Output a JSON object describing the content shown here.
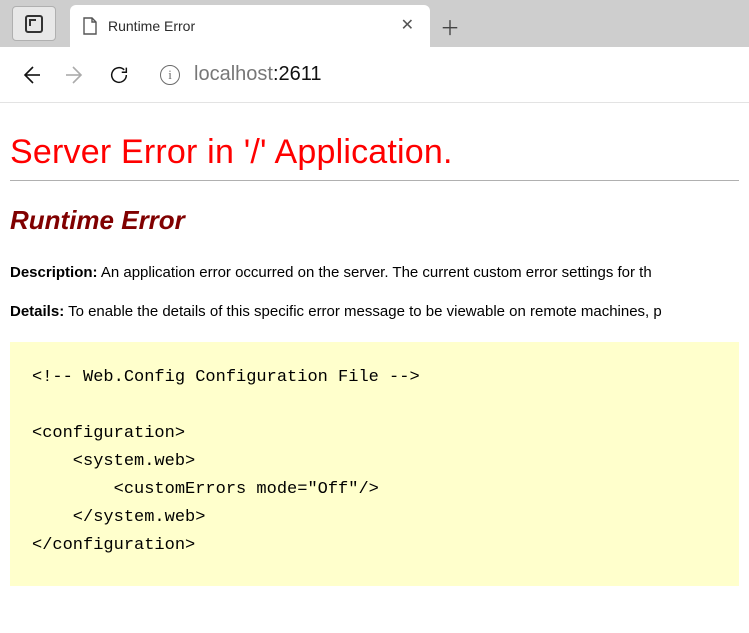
{
  "browser": {
    "tab_title": "Runtime Error",
    "address_host": "localhost",
    "address_port": ":2611"
  },
  "page": {
    "server_error_heading": "Server Error in '/' Application.",
    "runtime_heading": "Runtime Error",
    "description_label": "Description:",
    "description_text": " An application error occurred on the server. The current custom error settings for th",
    "details_label": "Details:",
    "details_text": " To enable the details of this specific error message to be viewable on remote machines, p",
    "config_code": "<!-- Web.Config Configuration File -->\n\n<configuration>\n    <system.web>\n        <customErrors mode=\"Off\"/>\n    </system.web>\n</configuration>"
  }
}
